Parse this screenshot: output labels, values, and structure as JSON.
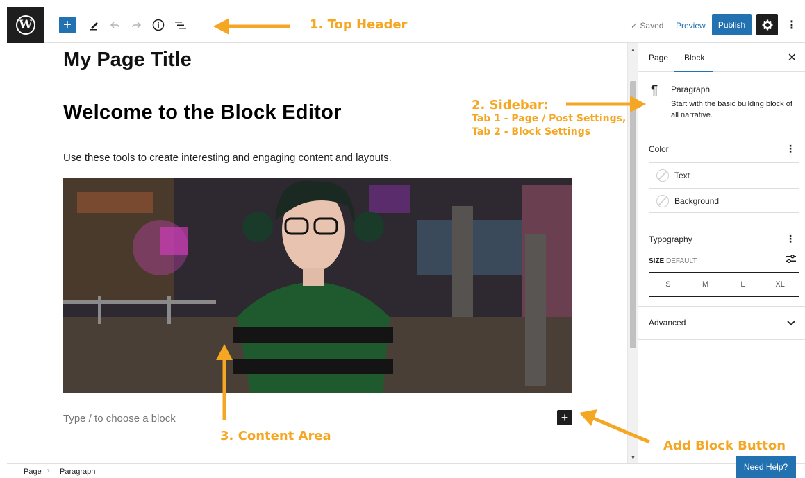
{
  "header": {
    "logo": "W",
    "add_icon": "+",
    "saved": "✓ Saved",
    "preview": "Preview",
    "publish": "Publish"
  },
  "editor": {
    "page_title": "My Page Title",
    "heading": "Welcome to the Block Editor",
    "intro": "Use these tools to create interesting and engaging content and layouts.",
    "placeholder": "Type / to choose a block"
  },
  "sidebar": {
    "tabs": [
      "Page",
      "Block"
    ],
    "block_name": "Paragraph",
    "block_desc": "Start with the basic building block of all narrative.",
    "color_title": "Color",
    "color_options": [
      "Text",
      "Background"
    ],
    "typography_title": "Typography",
    "size_label": "SIZE",
    "size_default": "DEFAULT",
    "sizes": [
      "S",
      "M",
      "L",
      "XL"
    ],
    "advanced_title": "Advanced"
  },
  "footer": {
    "breadcrumb": [
      "Page",
      "Paragraph"
    ],
    "help": "Need Help?"
  },
  "annotations": {
    "top_header": "1. Top Header",
    "sidebar_title": "2. Sidebar:",
    "sidebar_tab1": "Tab 1 - Page / Post Settings,",
    "sidebar_tab2": "Tab 2 - Block Settings",
    "content_area": "3. Content Area",
    "add_block": "Add Block Button"
  },
  "colors": {
    "accent": "#2271b1",
    "annotation": "#f5a623",
    "dark": "#1e1e1e"
  }
}
